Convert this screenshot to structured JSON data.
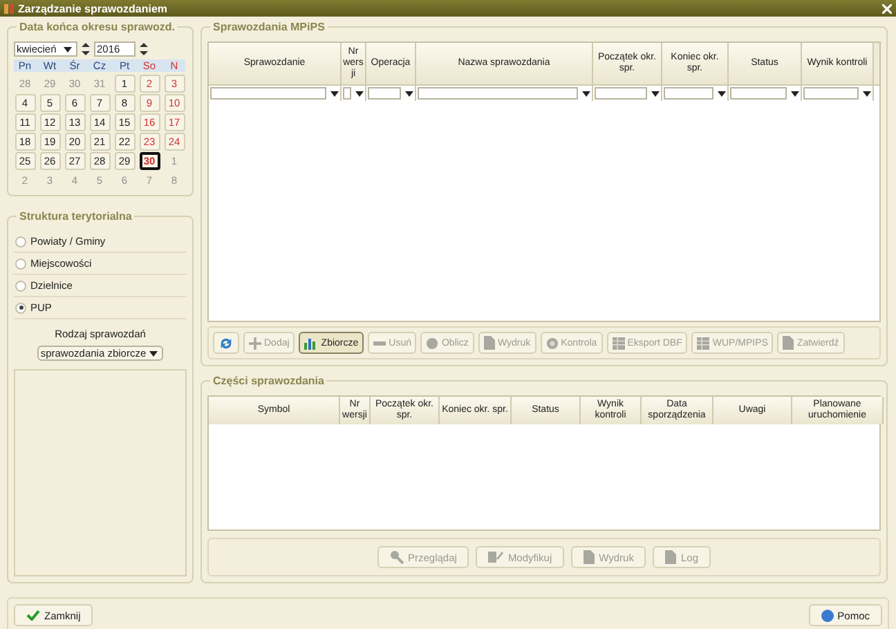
{
  "window": {
    "title": "Zarządzanie sprawozdaniem"
  },
  "calendar": {
    "legend": "Data końca okresu sprawozd.",
    "month": "kwiecień",
    "year": "2016",
    "weekdays": [
      "Pn",
      "Wt",
      "Śr",
      "Cz",
      "Pt",
      "So",
      "N"
    ],
    "weeks": [
      [
        {
          "day": "28",
          "outside": true,
          "selected": false
        },
        {
          "day": "29",
          "outside": true,
          "selected": false
        },
        {
          "day": "30",
          "outside": true,
          "selected": false
        },
        {
          "day": "31",
          "outside": true,
          "selected": false
        },
        {
          "day": "1",
          "outside": false,
          "selected": false
        },
        {
          "day": "2",
          "outside": false,
          "selected": false
        },
        {
          "day": "3",
          "outside": false,
          "selected": false
        }
      ],
      [
        {
          "day": "4",
          "outside": false,
          "selected": false
        },
        {
          "day": "5",
          "outside": false,
          "selected": false
        },
        {
          "day": "6",
          "outside": false,
          "selected": false
        },
        {
          "day": "7",
          "outside": false,
          "selected": false
        },
        {
          "day": "8",
          "outside": false,
          "selected": false
        },
        {
          "day": "9",
          "outside": false,
          "selected": false
        },
        {
          "day": "10",
          "outside": false,
          "selected": false
        }
      ],
      [
        {
          "day": "11",
          "outside": false,
          "selected": false
        },
        {
          "day": "12",
          "outside": false,
          "selected": false
        },
        {
          "day": "13",
          "outside": false,
          "selected": false
        },
        {
          "day": "14",
          "outside": false,
          "selected": false
        },
        {
          "day": "15",
          "outside": false,
          "selected": false
        },
        {
          "day": "16",
          "outside": false,
          "selected": false
        },
        {
          "day": "17",
          "outside": false,
          "selected": false
        }
      ],
      [
        {
          "day": "18",
          "outside": false,
          "selected": false
        },
        {
          "day": "19",
          "outside": false,
          "selected": false
        },
        {
          "day": "20",
          "outside": false,
          "selected": false
        },
        {
          "day": "21",
          "outside": false,
          "selected": false
        },
        {
          "day": "22",
          "outside": false,
          "selected": false
        },
        {
          "day": "23",
          "outside": false,
          "selected": false
        },
        {
          "day": "24",
          "outside": false,
          "selected": false
        }
      ],
      [
        {
          "day": "25",
          "outside": false,
          "selected": false
        },
        {
          "day": "26",
          "outside": false,
          "selected": false
        },
        {
          "day": "27",
          "outside": false,
          "selected": false
        },
        {
          "day": "28",
          "outside": false,
          "selected": false
        },
        {
          "day": "29",
          "outside": false,
          "selected": false
        },
        {
          "day": "30",
          "outside": false,
          "selected": true
        },
        {
          "day": "1",
          "outside": true,
          "selected": false
        }
      ],
      [
        {
          "day": "2",
          "outside": true,
          "selected": false
        },
        {
          "day": "3",
          "outside": true,
          "selected": false
        },
        {
          "day": "4",
          "outside": true,
          "selected": false
        },
        {
          "day": "5",
          "outside": true,
          "selected": false
        },
        {
          "day": "6",
          "outside": true,
          "selected": false
        },
        {
          "day": "7",
          "outside": true,
          "selected": false
        },
        {
          "day": "8",
          "outside": true,
          "selected": false
        }
      ]
    ]
  },
  "structure": {
    "legend": "Struktura terytorialna",
    "options": [
      {
        "label": "Powiaty / Gminy",
        "selected": false
      },
      {
        "label": "Miejscowości",
        "selected": false
      },
      {
        "label": "Dzielnice",
        "selected": false
      },
      {
        "label": "PUP",
        "selected": true
      }
    ],
    "report_type_label": "Rodzaj sprawozdań",
    "report_type_value": "sprawozdania zbiorcze"
  },
  "reports": {
    "legend": "Sprawozdania MPiPS",
    "columns": [
      "Sprawozdanie",
      "Nr wersji",
      "Operacja",
      "Nazwa sprawozdania",
      "Początek okr. spr.",
      "Koniec okr. spr.",
      "Status",
      "Wynik kontroli"
    ],
    "toolbar": [
      {
        "kind": "refresh",
        "disabled": false,
        "selected": false
      },
      {
        "kind": "add",
        "label": "Dodaj",
        "disabled": true,
        "selected": false
      },
      {
        "kind": "chart",
        "label": "Zbiorcze",
        "disabled": false,
        "selected": true
      },
      {
        "kind": "remove",
        "label": "Usuń",
        "disabled": true,
        "selected": false
      },
      {
        "kind": "compute",
        "label": "Oblicz",
        "disabled": true,
        "selected": false
      },
      {
        "kind": "doc",
        "label": "Wydruk",
        "disabled": true,
        "selected": false
      },
      {
        "kind": "check",
        "label": "Kontrola",
        "disabled": true,
        "selected": false
      },
      {
        "kind": "export",
        "label": "Eksport DBF",
        "disabled": true,
        "selected": false
      },
      {
        "kind": "export",
        "label": "WUP/MPIPS",
        "disabled": true,
        "selected": false
      },
      {
        "kind": "doc",
        "label": "Zatwierdź",
        "disabled": true,
        "selected": false
      }
    ]
  },
  "parts": {
    "legend": "Części sprawozdania",
    "columns": [
      "Symbol",
      "Nr wersji",
      "Początek okr. spr.",
      "Koniec okr. spr.",
      "Status",
      "Wynik kontroli",
      "Data sporządzenia",
      "Uwagi",
      "Planowane uruchomienie"
    ],
    "buttons": [
      {
        "kind": "search",
        "label": "Przeglądaj",
        "disabled": true
      },
      {
        "kind": "edit",
        "label": "Modyfikuj",
        "disabled": true
      },
      {
        "kind": "doc",
        "label": "Wydruk",
        "disabled": true
      },
      {
        "kind": "doc",
        "label": "Log",
        "disabled": true
      }
    ]
  },
  "footer": {
    "close": "Zamknij",
    "help": "Pomoc"
  }
}
